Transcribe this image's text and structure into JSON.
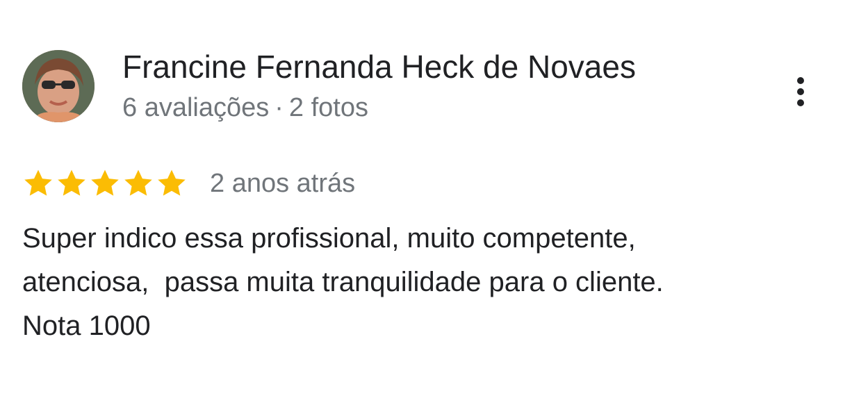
{
  "review": {
    "author_name": "Francine Fernanda Heck de Novaes",
    "meta": {
      "reviews_count": "6 avaliações",
      "separator": "·",
      "photos_count": "2 fotos"
    },
    "rating": {
      "stars": 5,
      "max_stars": 5
    },
    "time_ago": "2 anos atrás",
    "text_lines": [
      "Super indico essa profissional, muito competente,",
      "atenciosa,  passa muita tranquilidade para o cliente.",
      "Nota 1000"
    ]
  },
  "icons": {
    "avatar": "avatar-photo",
    "more": "more-vert-icon",
    "star": "star-icon"
  },
  "colors": {
    "star": "#fbbc04",
    "text_primary": "#202124",
    "text_secondary": "#70757a"
  }
}
